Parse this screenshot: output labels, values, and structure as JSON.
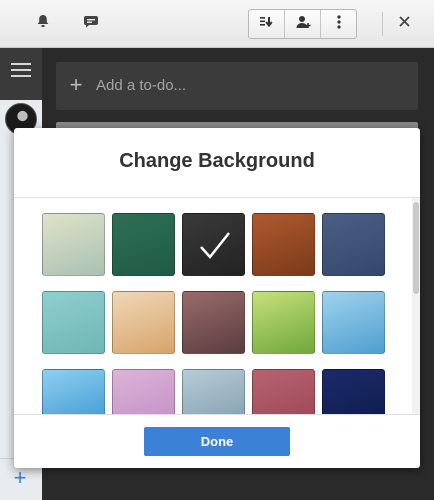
{
  "toolbar": {
    "icons": [
      "bell-icon",
      "comment-icon",
      "download-icon",
      "add-user-icon",
      "more-vertical-icon",
      "close-icon"
    ]
  },
  "main": {
    "add_todo_placeholder": "Add a to-do..."
  },
  "modal": {
    "title": "Change Background",
    "done_label": "Done",
    "selected_index": 2,
    "backgrounds": [
      {
        "name": "tower",
        "colors": [
          "#dfe3c8",
          "#a9c1b4"
        ]
      },
      {
        "name": "green",
        "colors": [
          "#2e6f57",
          "#1f5a45"
        ]
      },
      {
        "name": "dark",
        "colors": [
          "#3a3a3a",
          "#222222"
        ]
      },
      {
        "name": "wood",
        "colors": [
          "#b05a2e",
          "#7a3a1a"
        ]
      },
      {
        "name": "denim",
        "colors": [
          "#4b5f86",
          "#34476b"
        ]
      },
      {
        "name": "teal",
        "colors": [
          "#8fcfcf",
          "#6fb7b6"
        ]
      },
      {
        "name": "cat",
        "colors": [
          "#f0d8b6",
          "#d7a46b"
        ]
      },
      {
        "name": "fur",
        "colors": [
          "#9a6b6c",
          "#5a3d3f"
        ]
      },
      {
        "name": "grass",
        "colors": [
          "#c6e07c",
          "#6fa83b"
        ]
      },
      {
        "name": "raindrops",
        "colors": [
          "#9fd3ee",
          "#4f9fcf"
        ]
      },
      {
        "name": "sky",
        "colors": [
          "#8fd0ef",
          "#3a94d2"
        ]
      },
      {
        "name": "pink",
        "colors": [
          "#dcb3d8",
          "#c28ec4"
        ]
      },
      {
        "name": "slate",
        "colors": [
          "#b7ccd7",
          "#7e9cae"
        ]
      },
      {
        "name": "rose",
        "colors": [
          "#b7636f",
          "#9a4555"
        ]
      },
      {
        "name": "night",
        "colors": [
          "#1b2b6b",
          "#0d1a46"
        ]
      }
    ]
  }
}
